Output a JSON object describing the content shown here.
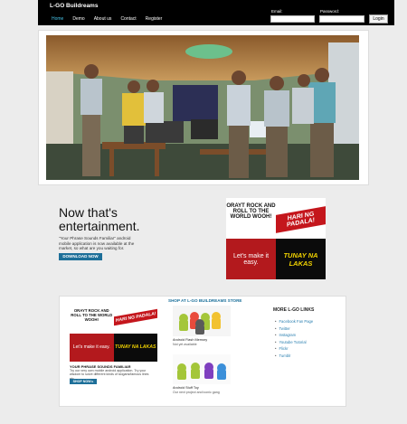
{
  "header": {
    "brand": "L-GO Buildreams",
    "nav": [
      "Home",
      "Demo",
      "About us",
      "Contact",
      "Register"
    ],
    "email_label": "Email:",
    "password_label": "Password:",
    "login_button": "Login"
  },
  "promo": {
    "title": "Now that's entertainment.",
    "description": "\"Your Phrase Sounds Familiar\" android mobile application is now available at the market, so what are you waiting for.",
    "download_button": "DOWNLOAD NOW"
  },
  "banner": {
    "top_left": "ORAYT ROCK AND ROLL TO THE WORLD WOOH!",
    "top_right": "HARI NG PADALA!",
    "bottom_left": "Let's make it easy.",
    "bottom_right": "TUNAY NA LAKAS"
  },
  "shop": {
    "title": "SHOP AT L-GO BUILDREAMS STORE",
    "products": [
      {
        "name": "Android Flash Memory",
        "sub": "Not yet available"
      },
      {
        "name": "Android Stuff Toy",
        "sub": "Our next project and iconic gang"
      }
    ],
    "featured_title": "YOUR PHRASE SOUNDS FAMILIAR",
    "featured_desc": "Try our very own mobile android application. Try your wisdom to solve different kinds of slogans/famous lines etc...",
    "shop_button": "SHOP NOW ▸"
  },
  "more_links": {
    "title": "MORE L-GO LINKS",
    "items": [
      "Facebook Fan Page",
      "Twitter",
      "Instagram",
      "Youtube Tutorial",
      "Flickr",
      "Tumblr"
    ]
  },
  "colors": {
    "accent": "#1d6f99",
    "nav_active": "#46c2e6",
    "banner_red": "#c4161c",
    "banner_yellow": "#f2d300"
  }
}
